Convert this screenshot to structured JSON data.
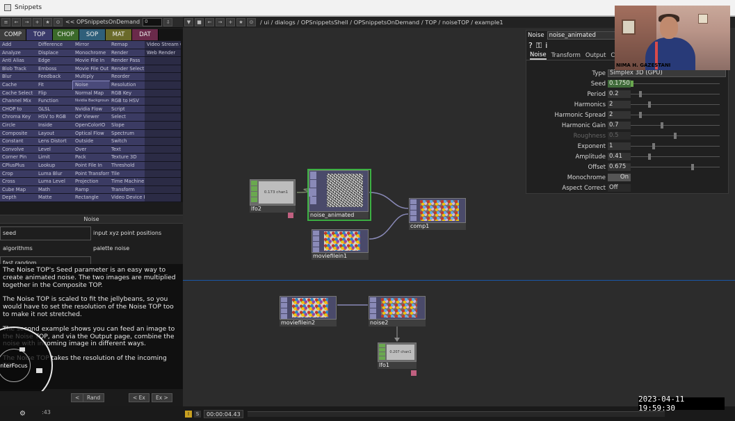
{
  "window": {
    "title": "Snippets"
  },
  "left_toolbar": {
    "path": "<< OPSnippetsOnDemand",
    "field": "0"
  },
  "families": [
    "COMP",
    "TOP",
    "CHOP",
    "SOP",
    "MAT",
    "DAT"
  ],
  "op_columns": [
    [
      "Add",
      "Analyze",
      "Anti Alias",
      "Blob Track",
      "Blur",
      "Cache",
      "Cache Select",
      "Channel Mix",
      "CHOP to",
      "Chroma Key",
      "Circle",
      "Composite",
      "Constant",
      "Convolve",
      "Corner Pin",
      "CPlusPlus",
      "Crop",
      "Cross",
      "Cube Map",
      "Depth"
    ],
    [
      "Difference",
      "Displace",
      "Edge",
      "Emboss",
      "Feedback",
      "Fit",
      "Flip",
      "Function",
      "GLSL",
      "HSV to RGB",
      "Inside",
      "Layout",
      "Lens Distort",
      "Level",
      "Limit",
      "Lookup",
      "Luma Blur",
      "Luma Level",
      "Math",
      "Matte"
    ],
    [
      "Mirror",
      "Monochrome",
      "Movie File In",
      "Movie File Out",
      "Multiply",
      "Noise",
      "Normal Map",
      "Nvidia Background",
      "Nvidia Flow",
      "OP Viewer",
      "OpenColorIO",
      "Optical Flow",
      "Outside",
      "Over",
      "Pack",
      "Point File In",
      "Point Transform",
      "Projection",
      "Ramp",
      "Rectangle"
    ],
    [
      "Remap",
      "Render",
      "Render Pass",
      "Render Select",
      "Reorder",
      "Resolution",
      "RGB Key",
      "RGB to HSV",
      "Script",
      "Select",
      "Slope",
      "Spectrum",
      "Switch",
      "Text",
      "Texture 3D",
      "Threshold",
      "Tile",
      "Time Machine",
      "Transform",
      "Video Device In"
    ],
    [
      "Video Stream Out",
      "Web Render"
    ]
  ],
  "section_title": "Noise",
  "examples": {
    "left": [
      "seed",
      "algorithms",
      "fast random"
    ],
    "right": [
      "input xyz point positions",
      "palette noise"
    ]
  },
  "description": [
    "The Noise TOP's Seed parameter is an easy way to create animated noise. The two images are multiplied together in the Composite TOP.",
    "The Noise TOP is scaled to fit the jellybeans, so you would have to set the resolution of the Noise TOP too to make it not stretched.",
    "The second example shows you can feed an image to the Noise TOP, and via the Output page, combine the noise with incoming image in different ways.",
    "The Noise TOP takes the resolution of the incoming TOP."
  ],
  "dial": {
    "label": "interFocus"
  },
  "left_buttons": {
    "prev": "<",
    "rand": "Rand",
    "prev_ex": "< Ex",
    "next_ex": "Ex >"
  },
  "net_toolbar": {
    "path": "/ ui / dialogs / OPSnippetsShell / OPSnippetsOnDemand / TOP / noiseTOP / example1"
  },
  "nodes": {
    "lfo2": {
      "name": "lfo2",
      "readout": "0.173 chan1"
    },
    "noise_animated": {
      "name": "noise_animated"
    },
    "comp1": {
      "name": "comp1"
    },
    "moviefilein1": {
      "name": "moviefilein1"
    },
    "moviefilein2": {
      "name": "moviefilein2"
    },
    "noise2": {
      "name": "noise2"
    },
    "lfo1": {
      "name": "lfo1",
      "readout": "0.207 chan1"
    }
  },
  "params": {
    "op_type": "Noise",
    "op_name": "noise_animated",
    "tabs": [
      "Noise",
      "Transform",
      "Output",
      "Co"
    ],
    "type_label": "Type",
    "type_value": "Simplex 3D (GPU)",
    "rows": [
      {
        "label": "Seed",
        "value": "0.1750",
        "pos": 0.0
      },
      {
        "label": "Period",
        "value": "0.2",
        "pos": 0.1
      },
      {
        "label": "Harmonics",
        "value": "2",
        "pos": 0.2
      },
      {
        "label": "Harmonic Spread",
        "value": "2",
        "pos": 0.1
      },
      {
        "label": "Harmonic Gain",
        "value": "0.7",
        "pos": 0.35
      },
      {
        "label": "Roughness",
        "value": "0.5",
        "pos": 0.5,
        "dim": true
      },
      {
        "label": "Exponent",
        "value": "1",
        "pos": 0.25
      },
      {
        "label": "Amplitude",
        "value": "0.41",
        "pos": 0.2
      },
      {
        "label": "Offset",
        "value": "0.675",
        "pos": 0.7
      }
    ],
    "monochrome_label": "Monochrome",
    "monochrome_value": "On",
    "aspect_label": "Aspect Correct",
    "aspect_value": "Off"
  },
  "webcam": {
    "caption": "NIMA H. GAZESTANI"
  },
  "status": {
    "s1": "I",
    "s2": "S",
    "time": "00:00:04.43",
    "left_time": ":43"
  },
  "timestamp": "2023-04-11  19:59:30",
  "colors": {
    "accent_green": "#4caf50",
    "divider_blue": "#1a58a8",
    "op_blue": "#3b3b63"
  }
}
